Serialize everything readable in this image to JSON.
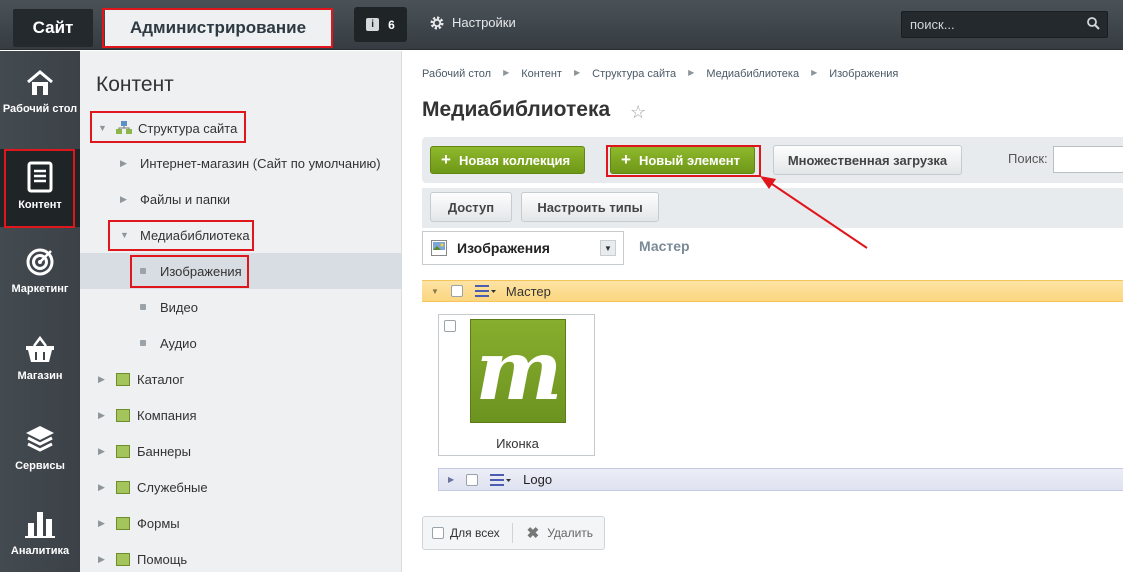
{
  "topbar": {
    "site_label": "Сайт",
    "admin_label": "Администрирование",
    "notifications_count": "6",
    "settings_label": "Настройки",
    "search_placeholder": "поиск..."
  },
  "leftnav": [
    {
      "label": "Рабочий стол",
      "icon": "home-icon"
    },
    {
      "label": "Контент",
      "icon": "document-icon"
    },
    {
      "label": "Маркетинг",
      "icon": "target-icon"
    },
    {
      "label": "Магазин",
      "icon": "basket-icon"
    },
    {
      "label": "Сервисы",
      "icon": "layers-icon"
    },
    {
      "label": "Аналитика",
      "icon": "bar-chart-icon"
    }
  ],
  "sidebar": {
    "title": "Контент",
    "tree": [
      "Структура сайта",
      "Интернет-магазин (Сайт по умолчанию)",
      "Файлы и папки",
      "Медиабиблиотека",
      "Изображения",
      "Видео",
      "Аудио",
      "Каталог",
      "Компания",
      "Баннеры",
      "Служебные",
      "Формы",
      "Помощь"
    ]
  },
  "breadcrumbs": [
    "Рабочий стол",
    "Контент",
    "Структура сайта",
    "Медиабиблиотека",
    "Изображения"
  ],
  "page_title": "Медиабиблиотека",
  "toolbar": {
    "new_collection": "Новая коллекция",
    "new_element": "Новый элемент",
    "multi_upload": "Множественная загрузка",
    "search_label": "Поиск:",
    "access": "Доступ",
    "configure_types": "Настроить типы"
  },
  "collection_select": {
    "value": "Изображения"
  },
  "master_label": "Мастер",
  "section": {
    "name": "Мастер"
  },
  "items": [
    {
      "caption": "Иконка",
      "thumb_letter": "m"
    }
  ],
  "subsection": {
    "name": "Logo"
  },
  "bottom": {
    "for_all": "Для всех",
    "delete": "Удалить"
  },
  "colors": {
    "accent_green": "#7aa21f",
    "annotation_red": "#e0161d",
    "section_orange": "#fcd67f"
  }
}
